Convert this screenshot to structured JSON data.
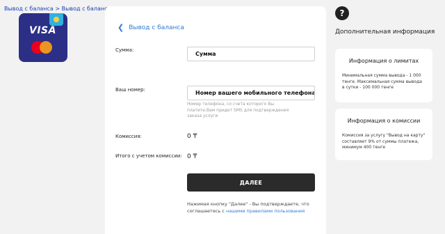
{
  "breadcrumb": {
    "item1": "Вывод с баланса",
    "separator": ">",
    "item2": "Вывод с баланса"
  },
  "logo": {
    "brand": "VISA",
    "icons": [
      "visa-mastercard-logo",
      "kazakhstan-flag-icon"
    ],
    "colors": {
      "background": "#2b2f86",
      "mc_red": "#eb001b",
      "mc_orange": "#f79e1b"
    }
  },
  "form": {
    "back_label": "Вывод с баланса",
    "amount_label": "Сумма:",
    "amount_placeholder": "Сумма",
    "phone_label": "Ваш номер:",
    "phone_placeholder": "Номер вашего мобильного телефона",
    "phone_hint": "Номер телефона, со счета которого Вы платите.Вам придет SMS для подтверждения заказа услуги",
    "commission_label": "Комиссия:",
    "commission_value": "0 ₸",
    "total_label": "Итого с учетом комиссии:",
    "total_value": "0 ₸",
    "submit_label": "ДАЛЕЕ",
    "agree_text": "Нажимая кнопку \"Далее\" - Вы подтверждаете, что соглашаетесь с",
    "agree_link": "нашими правилами пользования"
  },
  "sidebar": {
    "help_glyph": "?",
    "title": "Дополнительная информация",
    "limits": {
      "title": "Информация о лимитах",
      "text": "Минимальная сумма вывода - 1 000 тенге. Максимальная сумма вывода в сутки - 100 000 тенге"
    },
    "commission": {
      "title": "Информация о комиссии",
      "text": "Комиссия за услугу \"Вывод на карту\" составляет 9% от суммы платежа, минимум 400 тенге"
    }
  },
  "colors": {
    "accent": "#2f7ad6",
    "button": "#2b2b2b",
    "page_bg": "#f2f2f2"
  }
}
